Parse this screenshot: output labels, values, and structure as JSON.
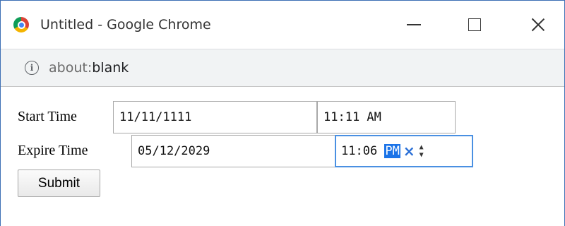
{
  "window": {
    "title": "Untitled - Google Chrome",
    "minimize_icon": "minimize-icon",
    "maximize_icon": "maximize-icon",
    "close_icon": "close-icon"
  },
  "address_bar": {
    "info_icon": "info-icon",
    "info_glyph": "i",
    "url_scheme": "about:",
    "url_rest": "blank"
  },
  "form": {
    "start_time": {
      "label": "Start Time",
      "date_value": "11/11/1111",
      "time_value": "11:11 AM"
    },
    "expire_time": {
      "label": "Expire Time",
      "date_value": "05/12/2029",
      "time_hour_min": "11:06 ",
      "time_ampm": "PM",
      "clear_glyph": "×",
      "spin_up": "▲",
      "spin_down": "▼"
    },
    "submit_label": "Submit"
  },
  "colors": {
    "window_border": "#3c6fb4",
    "selection": "#1a73e8",
    "focus_ring": "#4a90e2"
  }
}
